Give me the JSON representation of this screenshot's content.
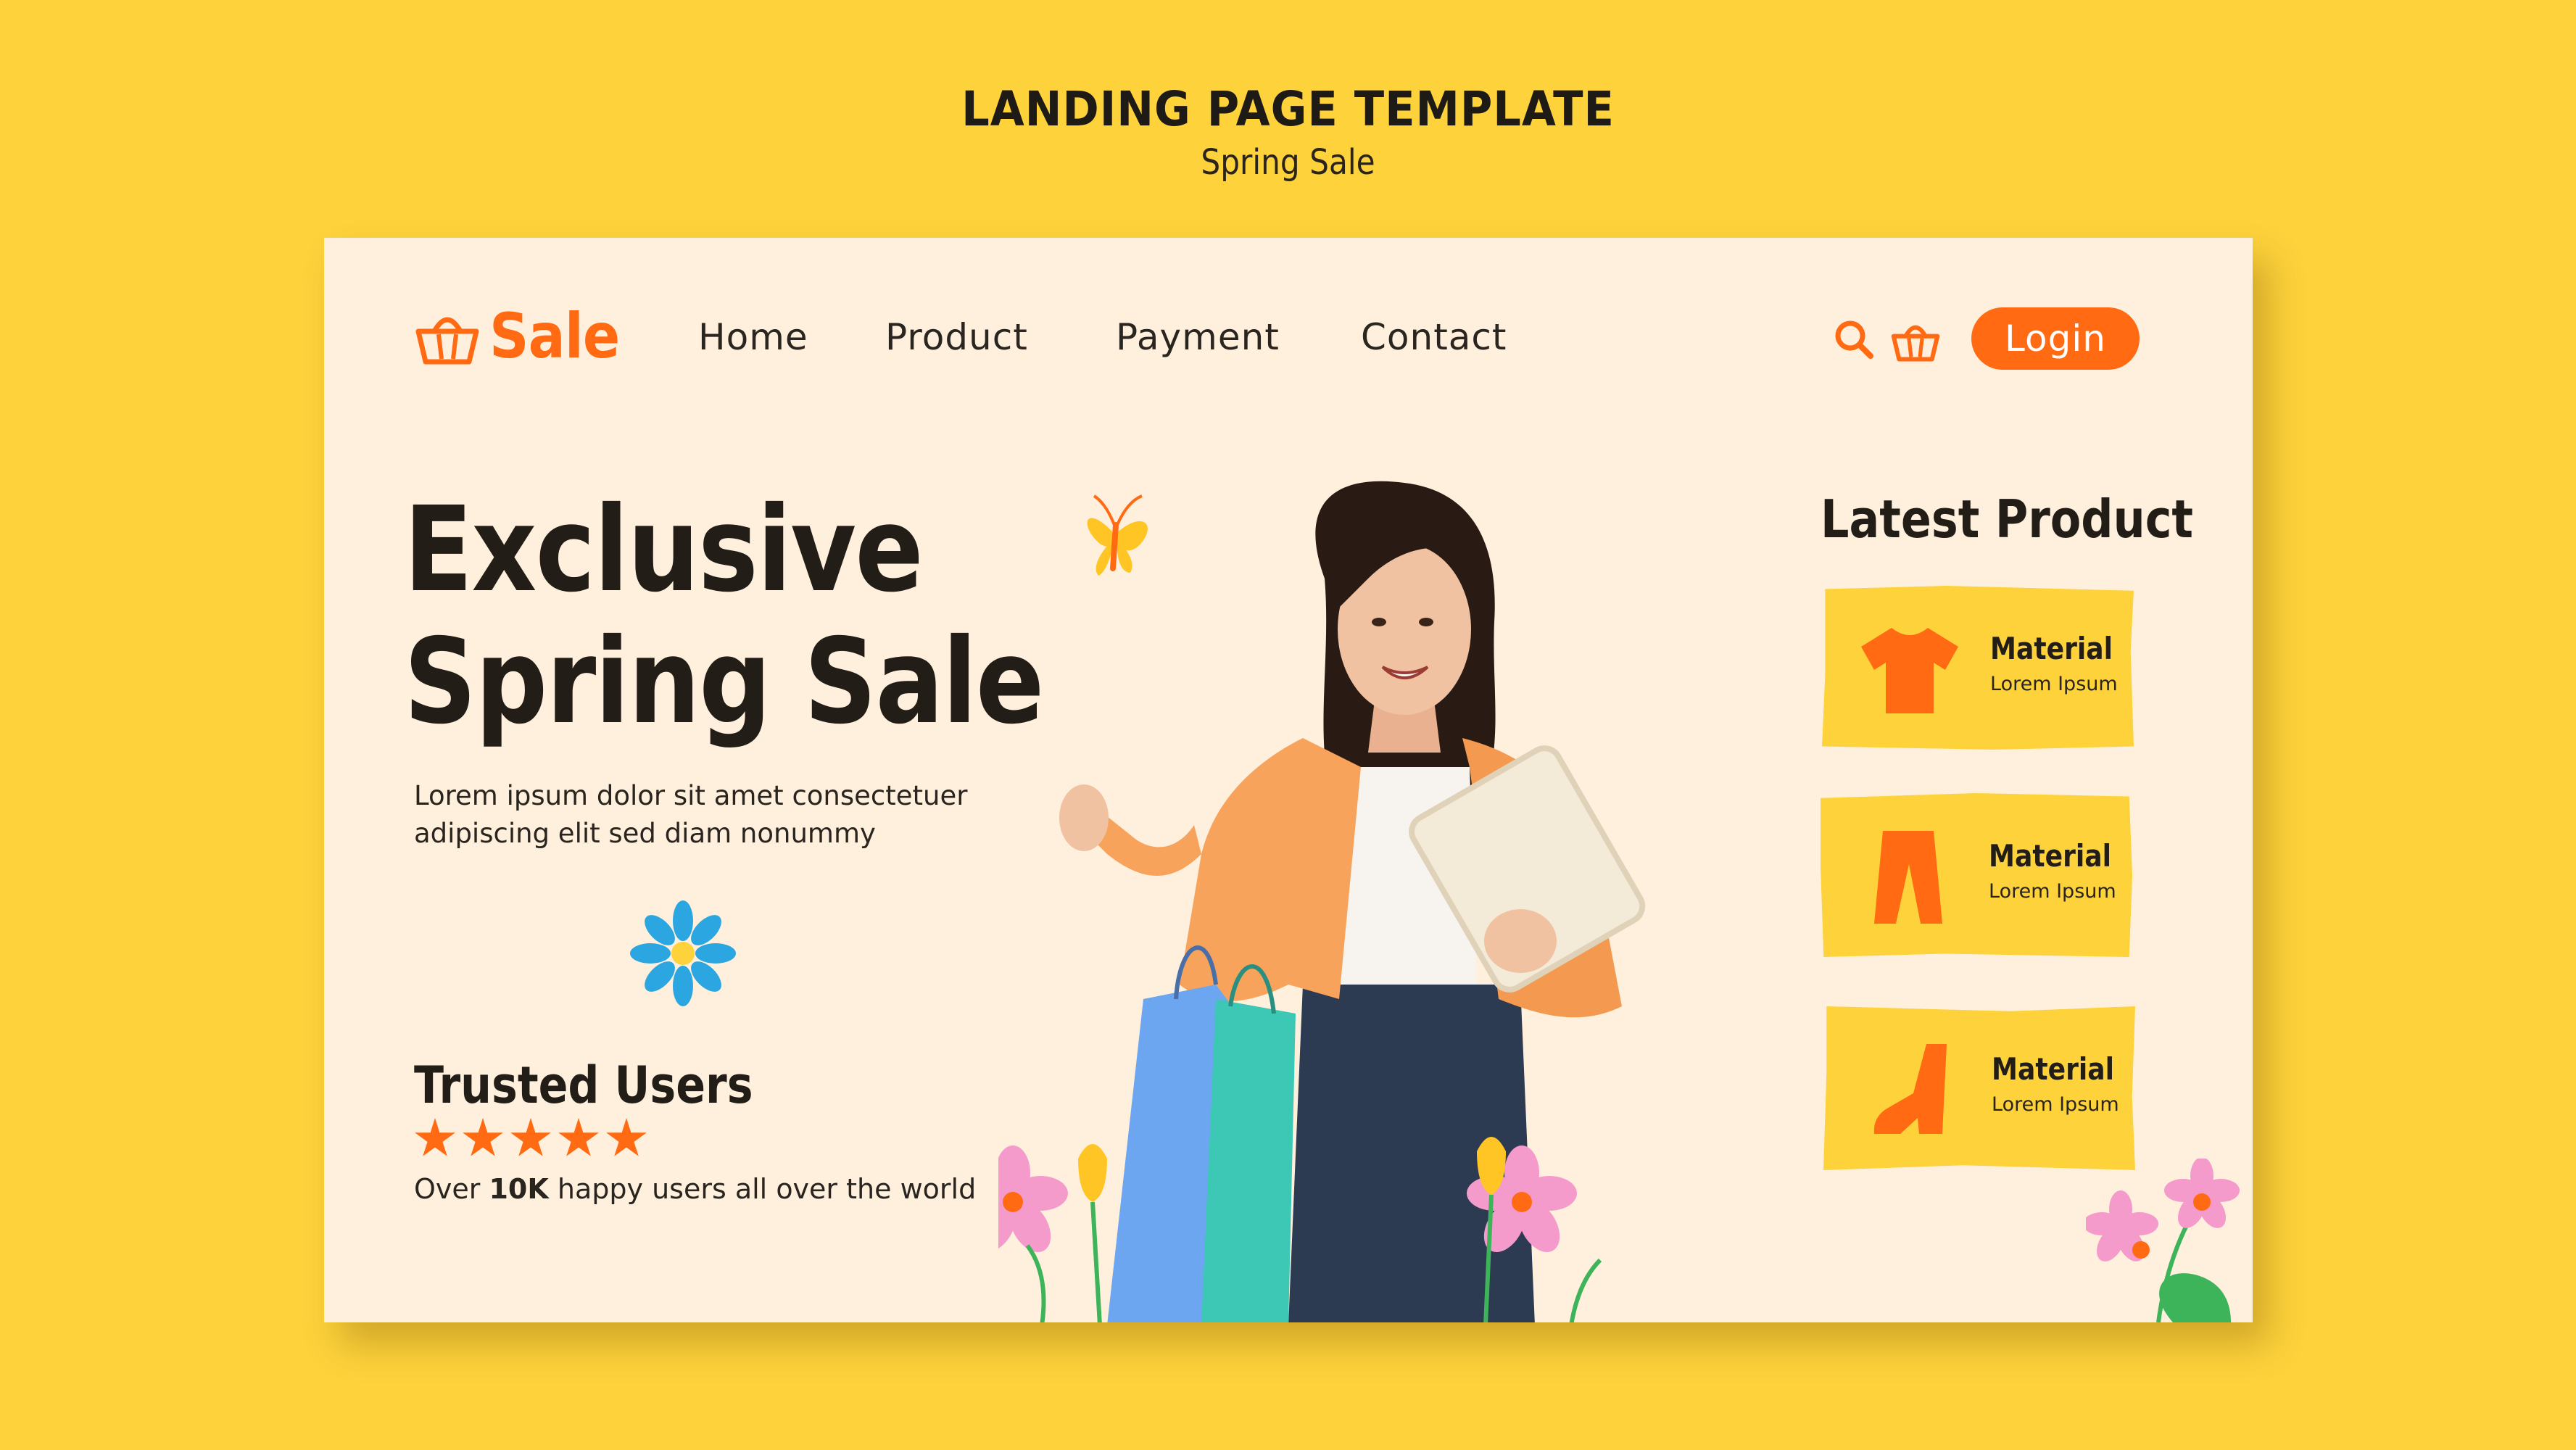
{
  "heading": {
    "title": "LANDING PAGE TEMPLATE",
    "subtitle": "Spring Sale"
  },
  "colors": {
    "background": "#FDD23B",
    "card": "#FFF0DD",
    "accent": "#FF6A13",
    "text": "#231D17"
  },
  "nav": {
    "brand": "Sale",
    "brand_icon": "basket-icon",
    "links": [
      "Home",
      "Product",
      "Payment",
      "Contact"
    ],
    "search_icon": "search-icon",
    "cart_icon": "basket-icon",
    "login": "Login"
  },
  "hero": {
    "title_line1": "Exclusive",
    "title_line2": "Spring Sale",
    "description_line1": "Lorem ipsum dolor sit amet consectetuer",
    "description_line2": "adipiscing elit sed diam nonummy"
  },
  "trusted": {
    "title": "Trusted Users",
    "rating": 5,
    "text_before": "Over ",
    "highlight": "10K",
    "text_after": " happy users all over the world"
  },
  "latest": {
    "title": "Latest Product",
    "items": [
      {
        "icon": "tshirt-icon",
        "name": "Material",
        "desc": "Lorem Ipsum"
      },
      {
        "icon": "trousers-icon",
        "name": "Material",
        "desc": "Lorem Ipsum"
      },
      {
        "icon": "boot-icon",
        "name": "Material",
        "desc": "Lorem Ipsum"
      }
    ]
  }
}
